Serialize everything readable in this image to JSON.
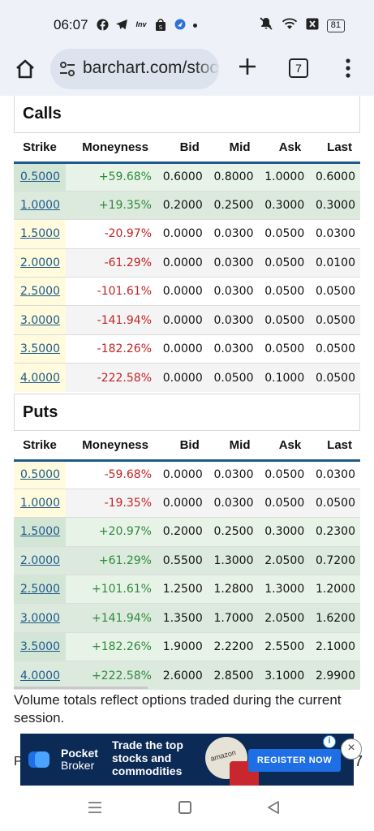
{
  "status_bar": {
    "time": "06:07",
    "battery": "81",
    "icons_left": [
      "facebook-icon",
      "telegram-icon",
      "investing-icon",
      "shop-icon",
      "app-icon"
    ],
    "icons_right": [
      "mute-icon",
      "wifi-icon",
      "close-box-icon",
      "battery-icon"
    ]
  },
  "browser": {
    "url": "barchart.com/stocks/quotes",
    "tab_count": "7"
  },
  "calls": {
    "title": "Calls",
    "headers": [
      "Strike",
      "Moneyness",
      "Bid",
      "Mid",
      "Ask",
      "Last"
    ],
    "rows": [
      {
        "strike": "0.5000",
        "moneyness": "+59.68%",
        "bid": "0.6000",
        "mid": "0.8000",
        "ask": "1.0000",
        "last": "0.6000"
      },
      {
        "strike": "1.0000",
        "moneyness": "+19.35%",
        "bid": "0.2000",
        "mid": "0.2500",
        "ask": "0.3000",
        "last": "0.3000"
      },
      {
        "strike": "1.5000",
        "moneyness": "-20.97%",
        "bid": "0.0000",
        "mid": "0.0300",
        "ask": "0.0500",
        "last": "0.0300"
      },
      {
        "strike": "2.0000",
        "moneyness": "-61.29%",
        "bid": "0.0000",
        "mid": "0.0300",
        "ask": "0.0500",
        "last": "0.0100"
      },
      {
        "strike": "2.5000",
        "moneyness": "-101.61%",
        "bid": "0.0000",
        "mid": "0.0300",
        "ask": "0.0500",
        "last": "0.0500"
      },
      {
        "strike": "3.0000",
        "moneyness": "-141.94%",
        "bid": "0.0000",
        "mid": "0.0300",
        "ask": "0.0500",
        "last": "0.0500"
      },
      {
        "strike": "3.5000",
        "moneyness": "-182.26%",
        "bid": "0.0000",
        "mid": "0.0300",
        "ask": "0.0500",
        "last": "0.0500"
      },
      {
        "strike": "4.0000",
        "moneyness": "-222.58%",
        "bid": "0.0000",
        "mid": "0.0500",
        "ask": "0.1000",
        "last": "0.0500"
      }
    ]
  },
  "puts": {
    "title": "Puts",
    "headers": [
      "Strike",
      "Moneyness",
      "Bid",
      "Mid",
      "Ask",
      "Last"
    ],
    "rows": [
      {
        "strike": "0.5000",
        "moneyness": "-59.68%",
        "bid": "0.0000",
        "mid": "0.0300",
        "ask": "0.0500",
        "last": "0.0300"
      },
      {
        "strike": "1.0000",
        "moneyness": "-19.35%",
        "bid": "0.0000",
        "mid": "0.0300",
        "ask": "0.0500",
        "last": "0.0500"
      },
      {
        "strike": "1.5000",
        "moneyness": "+20.97%",
        "bid": "0.2000",
        "mid": "0.2500",
        "ask": "0.3000",
        "last": "0.2300"
      },
      {
        "strike": "2.0000",
        "moneyness": "+61.29%",
        "bid": "0.5500",
        "mid": "1.3000",
        "ask": "2.0500",
        "last": "0.7200"
      },
      {
        "strike": "2.5000",
        "moneyness": "+101.61%",
        "bid": "1.2500",
        "mid": "1.2800",
        "ask": "1.3000",
        "last": "1.2000"
      },
      {
        "strike": "3.0000",
        "moneyness": "+141.94%",
        "bid": "1.3500",
        "mid": "1.7000",
        "ask": "2.0500",
        "last": "1.6200"
      },
      {
        "strike": "3.5000",
        "moneyness": "+182.26%",
        "bid": "1.9000",
        "mid": "2.2200",
        "ask": "2.5500",
        "last": "2.1000"
      },
      {
        "strike": "4.0000",
        "moneyness": "+222.58%",
        "bid": "2.6000",
        "mid": "2.8500",
        "ask": "3.1000",
        "last": "2.9900"
      }
    ]
  },
  "footnote": "Volume totals reflect options traded during the current session.",
  "ad": {
    "brand_line1": "Pocket",
    "brand_line2": "Broker",
    "text_line1": "Trade the top",
    "text_line2": "stocks and",
    "text_line3": "commodities",
    "image_label": "amazon",
    "cta": "REGISTER NOW",
    "info": "i",
    "close": "×"
  },
  "peek": {
    "left": "P",
    "right": "7"
  },
  "colors": {
    "positive": "#2e8a3a",
    "negative": "#c42323",
    "link": "#1f5a8a",
    "itm_bg": "#e8f3e8",
    "ad_bg": "#0b2a55",
    "cta_bg": "#1e6ee6"
  }
}
